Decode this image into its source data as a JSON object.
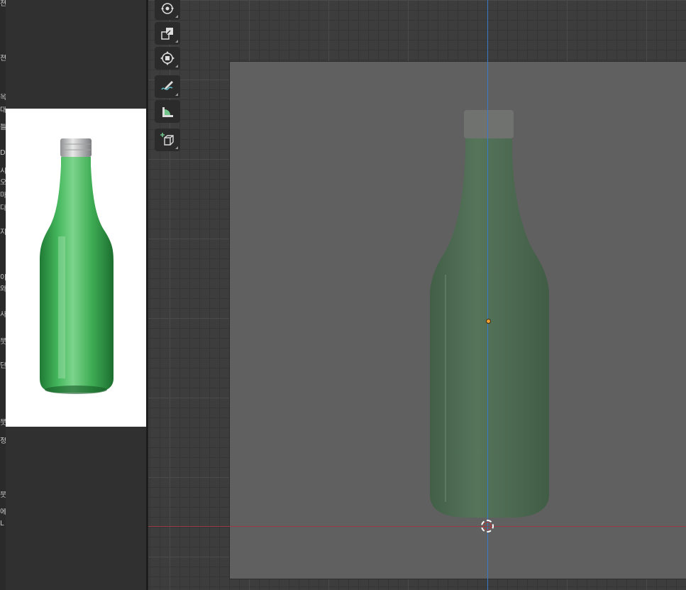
{
  "left_panel": {
    "edge_chars": [
      "쳔",
      "옥",
      "대",
      "틀",
      "D.",
      "시",
      "오",
      "마",
      "다",
      "지",
      "이",
      "와",
      "사",
      "붓",
      "단",
      "붓",
      "정",
      "붓",
      "에",
      "L"
    ]
  },
  "toolbar": {
    "tools": [
      {
        "icon": "rotate-icon"
      },
      {
        "icon": "scale-icon"
      },
      {
        "icon": "transform-icon"
      },
      {
        "icon": "annotate-icon"
      },
      {
        "icon": "measure-icon"
      },
      {
        "icon": "add-cube-icon"
      }
    ]
  },
  "colors": {
    "bottle_green": "#3fae55",
    "bottle_ghost": "#4c6a4f",
    "axis_z": "#3a78c8",
    "axis_x": "#9a3a48",
    "origin": "#f0a030"
  }
}
